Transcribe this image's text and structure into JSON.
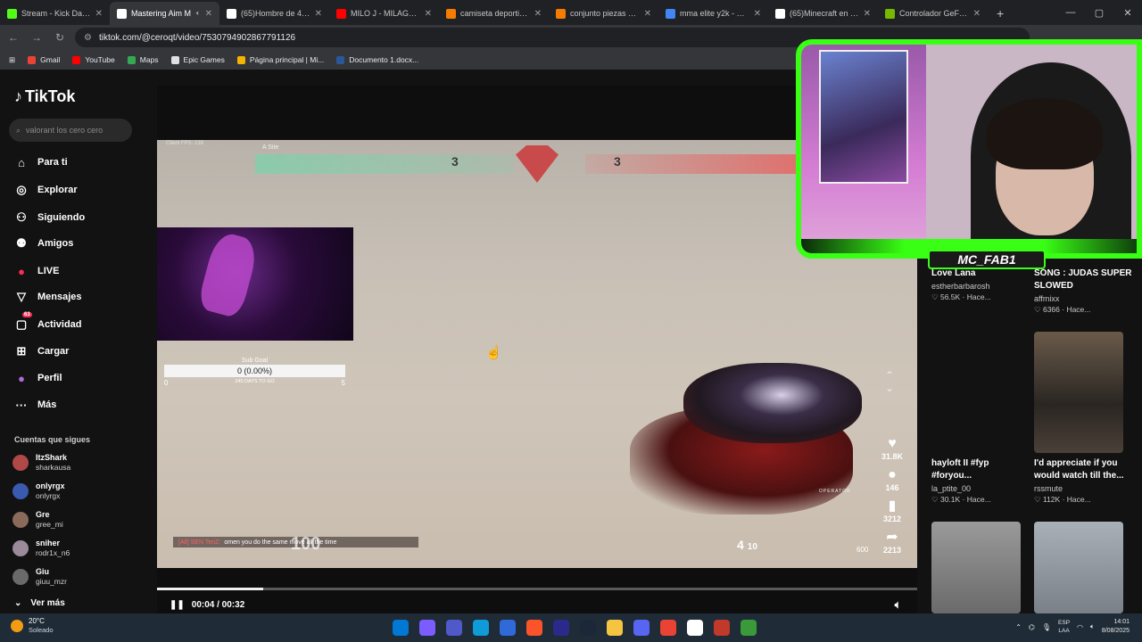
{
  "browser": {
    "tabs": [
      {
        "title": "Stream - Kick Dashb",
        "fav": "#53fc18",
        "active": false
      },
      {
        "title": "Mastering Aim M",
        "fav": "#ffffff",
        "active": true
      },
      {
        "title": "(65)Hombre de 41 añ",
        "fav": "#ffffff",
        "active": false
      },
      {
        "title": "MILO J - MILAGROS",
        "fav": "#ff0000",
        "active": false
      },
      {
        "title": "camiseta deportiva c",
        "fav": "#f57c00",
        "active": false
      },
      {
        "title": "conjunto piezas hom",
        "fav": "#f57c00",
        "active": false
      },
      {
        "title": "mma elite y2k - Busc",
        "fav": "#4285f4",
        "active": false
      },
      {
        "title": "(65)Minecraft en una",
        "fav": "#ffffff",
        "active": false
      },
      {
        "title": "Controlador GeForce",
        "fav": "#76b900",
        "active": false
      }
    ],
    "url": "tiktok.com/@ceroqt/video/7530794902867791126",
    "bookmarks": [
      {
        "label": "Gmail",
        "fav": "#ea4335"
      },
      {
        "label": "YouTube",
        "fav": "#ff0000"
      },
      {
        "label": "Maps",
        "fav": "#34a853"
      },
      {
        "label": "Epic Games",
        "fav": "#e0e0e0"
      },
      {
        "label": "Página principal | Mi...",
        "fav": "#f4b400"
      },
      {
        "label": "Documento 1.docx...",
        "fav": "#2b579a"
      }
    ]
  },
  "tiktok": {
    "logo": "TikTok",
    "search_placeholder": "valorant los cero cero",
    "nav": [
      {
        "label": "Para ti",
        "icon": "home-icon",
        "glyph": "⌂"
      },
      {
        "label": "Explorar",
        "icon": "compass-icon",
        "glyph": "◎"
      },
      {
        "label": "Siguiendo",
        "icon": "person-icon",
        "glyph": "⚇"
      },
      {
        "label": "Amigos",
        "icon": "friends-icon",
        "glyph": "⚉"
      },
      {
        "label": "LIVE",
        "icon": "live-icon",
        "glyph": "●"
      },
      {
        "label": "Mensajes",
        "icon": "message-icon",
        "glyph": "▽"
      },
      {
        "label": "Actividad",
        "icon": "inbox-icon",
        "glyph": "▢",
        "badge": "63"
      },
      {
        "label": "Cargar",
        "icon": "upload-icon",
        "glyph": "⊞"
      },
      {
        "label": "Perfil",
        "icon": "profile-icon",
        "glyph": "●"
      },
      {
        "label": "Más",
        "icon": "more-icon",
        "glyph": "···"
      }
    ],
    "following_title": "Cuentas que sigues",
    "following": [
      {
        "name": "ItzShark",
        "handle": "sharkausa"
      },
      {
        "name": "onlyrgx",
        "handle": "onlyrgx"
      },
      {
        "name": "Gre",
        "handle": "gree_mi"
      },
      {
        "name": "sniher",
        "handle": "rodr1x_n6"
      },
      {
        "name": "Giu",
        "handle": "giuu_mzr"
      }
    ],
    "ver_mas": "Ver más"
  },
  "video": {
    "fps": "Client FPS: 139",
    "site": "A Site",
    "score_left": "3",
    "score_right": "3",
    "subgoal_label": "Sub Goal",
    "subgoal_value": "0 (0.00%)",
    "subgoal_min": "0",
    "subgoal_days": "245 DAYS TO GO",
    "subgoal_max": "5",
    "chat_user": "[All] SEN TenZ:",
    "chat_msg": "omen you do the same move all the time",
    "health": "100",
    "ammo": "4",
    "ammo_reserve": "10",
    "credits": "600",
    "weapon_name": "OPERATOR",
    "likes": "31.8K",
    "comments": "146",
    "saves": "3212",
    "shares": "2213",
    "time": "00:04 / 00:32",
    "progress": 0.14,
    "streamer_name": "MC_FAB1"
  },
  "suggestions": [
    {
      "title": "Love Lana",
      "author": "estherbarbarosh",
      "stats": "♡ 56.5K · Hace..."
    },
    {
      "title": "SONG : JUDAS SUPER SLOWED",
      "author": "affmixx",
      "stats": "♡ 6366 · Hace..."
    },
    {
      "title": "hayloft II #fyp #foryou...",
      "author": "la_ptite_00",
      "stats": "♡ 30.1K · Hace..."
    },
    {
      "title": "I'd appreciate if you would watch till the...",
      "author": "rssmute",
      "stats": "♡ 112K · Hace..."
    }
  ],
  "taskbar": {
    "temp": "20°C",
    "condition": "Soleado",
    "lang_top": "ESP",
    "lang_bottom": "LAA",
    "time": "14:01",
    "date": "8/08/2025",
    "apps": [
      "#0078d4",
      "#7b5cff",
      "#5059c9",
      "#0f9bd7",
      "#2f6ad8",
      "#fb542b",
      "#2a2a8a",
      "#1b2838",
      "#f5c542",
      "#5865f2",
      "#ea4335",
      "#ffffff",
      "#c0392b",
      "#3a9a3a"
    ]
  }
}
